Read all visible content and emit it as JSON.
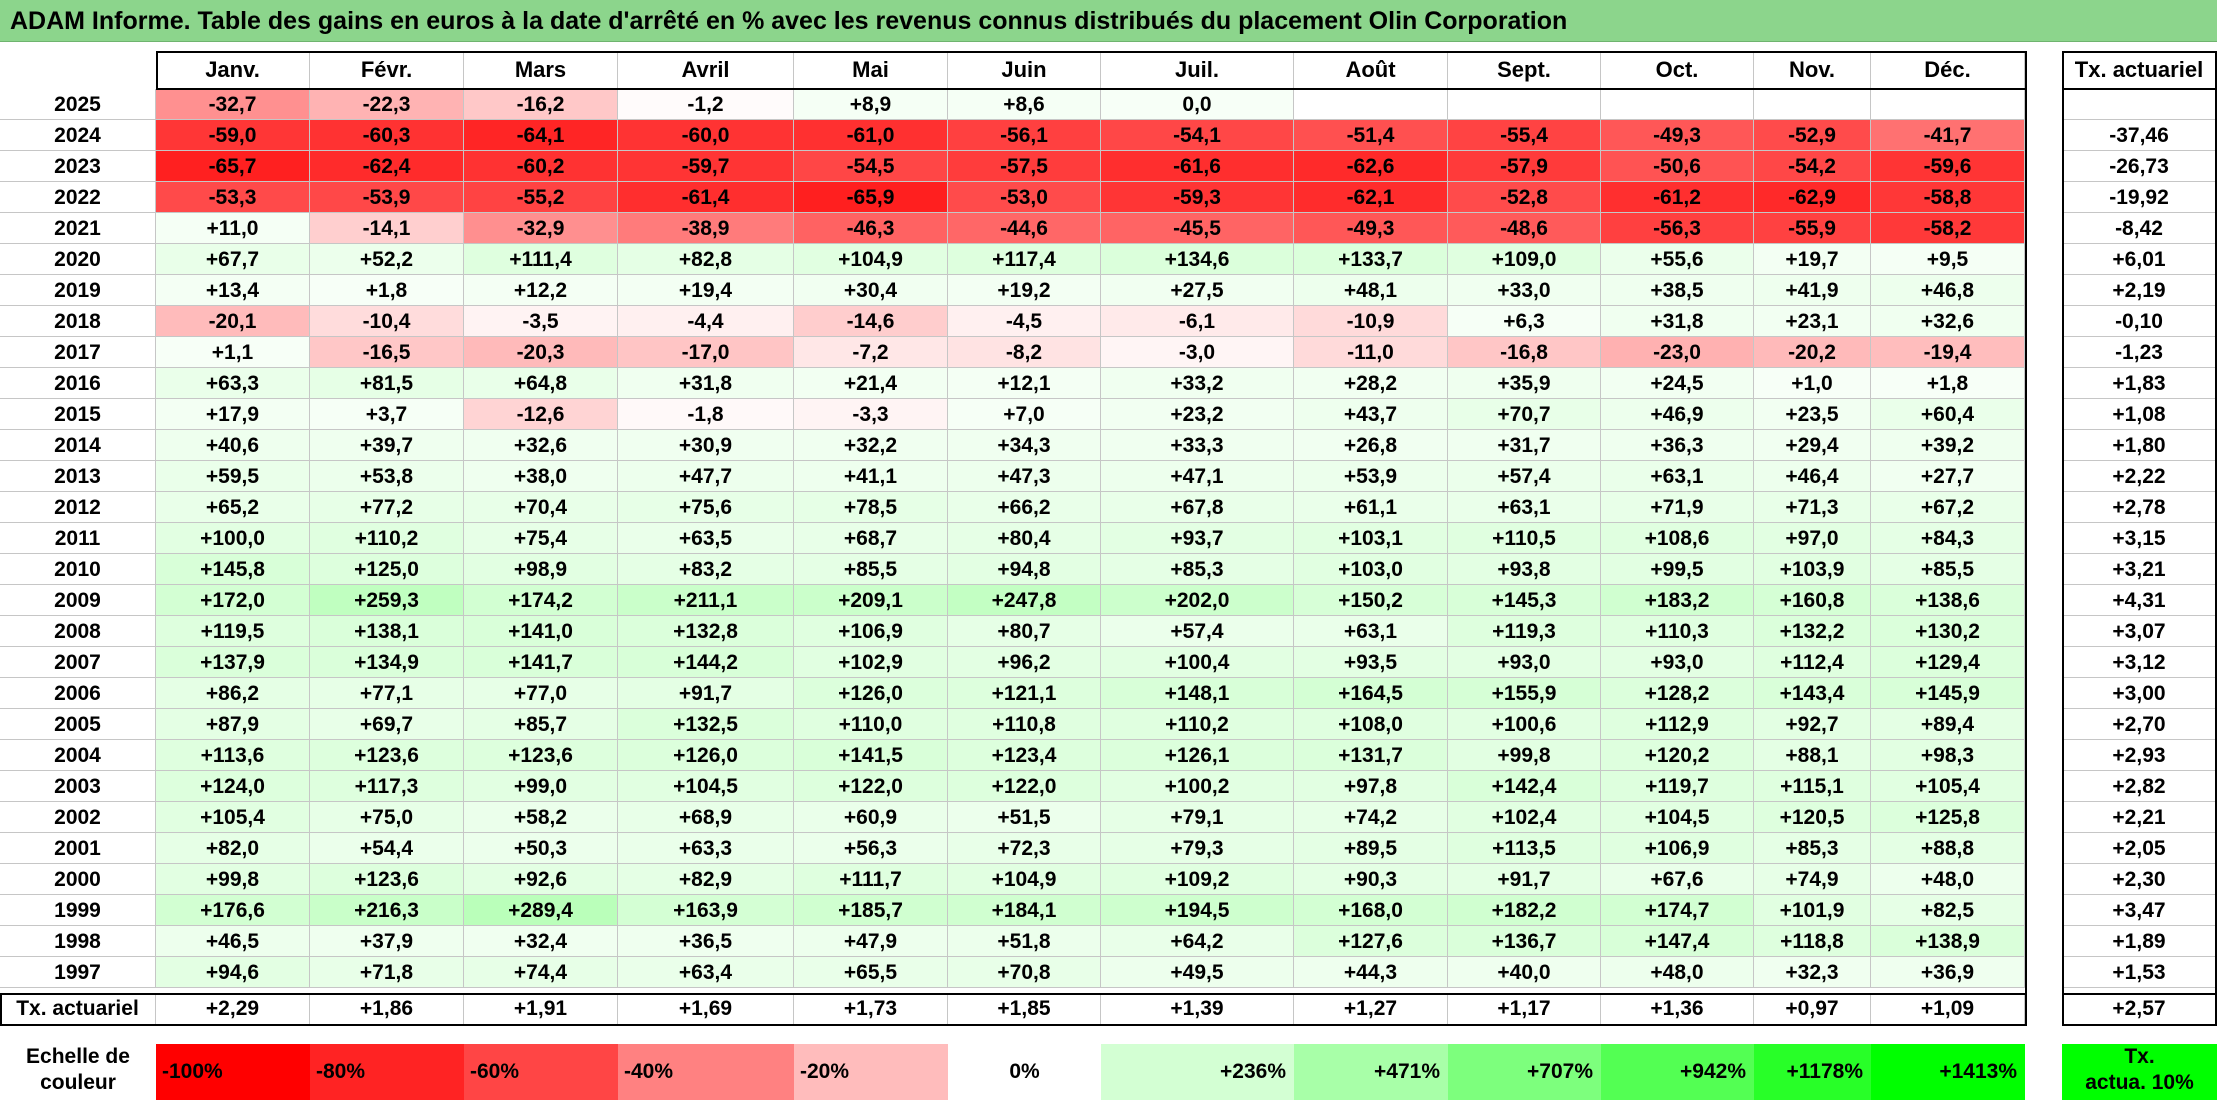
{
  "title": "ADAM Informe. Table des gains en euros à la date d'arrêté en % avec les revenus connus distribués du placement Olin Corporation",
  "months": [
    "Janv.",
    "Févr.",
    "Mars",
    "Avril",
    "Mai",
    "Juin",
    "Juil.",
    "Août",
    "Sept.",
    "Oct.",
    "Nov.",
    "Déc."
  ],
  "tx_header": "Tx. actuariel",
  "rows": [
    {
      "year": "2025",
      "cells": [
        "-32,7",
        "-22,3",
        "-16,2",
        "-1,2",
        "+8,9",
        "+8,6",
        "0,0",
        "",
        "",
        "",
        "",
        ""
      ],
      "tx": ""
    },
    {
      "year": "2024",
      "cells": [
        "-59,0",
        "-60,3",
        "-64,1",
        "-60,0",
        "-61,0",
        "-56,1",
        "-54,1",
        "-51,4",
        "-55,4",
        "-49,3",
        "-52,9",
        "-41,7"
      ],
      "tx": "-37,46"
    },
    {
      "year": "2023",
      "cells": [
        "-65,7",
        "-62,4",
        "-60,2",
        "-59,7",
        "-54,5",
        "-57,5",
        "-61,6",
        "-62,6",
        "-57,9",
        "-50,6",
        "-54,2",
        "-59,6"
      ],
      "tx": "-26,73"
    },
    {
      "year": "2022",
      "cells": [
        "-53,3",
        "-53,9",
        "-55,2",
        "-61,4",
        "-65,9",
        "-53,0",
        "-59,3",
        "-62,1",
        "-52,8",
        "-61,2",
        "-62,9",
        "-58,8"
      ],
      "tx": "-19,92"
    },
    {
      "year": "2021",
      "cells": [
        "+11,0",
        "-14,1",
        "-32,9",
        "-38,9",
        "-46,3",
        "-44,6",
        "-45,5",
        "-49,3",
        "-48,6",
        "-56,3",
        "-55,9",
        "-58,2"
      ],
      "tx": "-8,42"
    },
    {
      "year": "2020",
      "cells": [
        "+67,7",
        "+52,2",
        "+111,4",
        "+82,8",
        "+104,9",
        "+117,4",
        "+134,6",
        "+133,7",
        "+109,0",
        "+55,6",
        "+19,7",
        "+9,5"
      ],
      "tx": "+6,01"
    },
    {
      "year": "2019",
      "cells": [
        "+13,4",
        "+1,8",
        "+12,2",
        "+19,4",
        "+30,4",
        "+19,2",
        "+27,5",
        "+48,1",
        "+33,0",
        "+38,5",
        "+41,9",
        "+46,8"
      ],
      "tx": "+2,19"
    },
    {
      "year": "2018",
      "cells": [
        "-20,1",
        "-10,4",
        "-3,5",
        "-4,4",
        "-14,6",
        "-4,5",
        "-6,1",
        "-10,9",
        "+6,3",
        "+31,8",
        "+23,1",
        "+32,6"
      ],
      "tx": "-0,10"
    },
    {
      "year": "2017",
      "cells": [
        "+1,1",
        "-16,5",
        "-20,3",
        "-17,0",
        "-7,2",
        "-8,2",
        "-3,0",
        "-11,0",
        "-16,8",
        "-23,0",
        "-20,2",
        "-19,4"
      ],
      "tx": "-1,23"
    },
    {
      "year": "2016",
      "cells": [
        "+63,3",
        "+81,5",
        "+64,8",
        "+31,8",
        "+21,4",
        "+12,1",
        "+33,2",
        "+28,2",
        "+35,9",
        "+24,5",
        "+1,0",
        "+1,8"
      ],
      "tx": "+1,83"
    },
    {
      "year": "2015",
      "cells": [
        "+17,9",
        "+3,7",
        "-12,6",
        "-1,8",
        "-3,3",
        "+7,0",
        "+23,2",
        "+43,7",
        "+70,7",
        "+46,9",
        "+23,5",
        "+60,4"
      ],
      "tx": "+1,08"
    },
    {
      "year": "2014",
      "cells": [
        "+40,6",
        "+39,7",
        "+32,6",
        "+30,9",
        "+32,2",
        "+34,3",
        "+33,3",
        "+26,8",
        "+31,7",
        "+36,3",
        "+29,4",
        "+39,2"
      ],
      "tx": "+1,80"
    },
    {
      "year": "2013",
      "cells": [
        "+59,5",
        "+53,8",
        "+38,0",
        "+47,7",
        "+41,1",
        "+47,3",
        "+47,1",
        "+53,9",
        "+57,4",
        "+63,1",
        "+46,4",
        "+27,7"
      ],
      "tx": "+2,22"
    },
    {
      "year": "2012",
      "cells": [
        "+65,2",
        "+77,2",
        "+70,4",
        "+75,6",
        "+78,5",
        "+66,2",
        "+67,8",
        "+61,1",
        "+63,1",
        "+71,9",
        "+71,3",
        "+67,2"
      ],
      "tx": "+2,78"
    },
    {
      "year": "2011",
      "cells": [
        "+100,0",
        "+110,2",
        "+75,4",
        "+63,5",
        "+68,7",
        "+80,4",
        "+93,7",
        "+103,1",
        "+110,5",
        "+108,6",
        "+97,0",
        "+84,3"
      ],
      "tx": "+3,15"
    },
    {
      "year": "2010",
      "cells": [
        "+145,8",
        "+125,0",
        "+98,9",
        "+83,2",
        "+85,5",
        "+94,8",
        "+85,3",
        "+103,0",
        "+93,8",
        "+99,5",
        "+103,9",
        "+85,5"
      ],
      "tx": "+3,21"
    },
    {
      "year": "2009",
      "cells": [
        "+172,0",
        "+259,3",
        "+174,2",
        "+211,1",
        "+209,1",
        "+247,8",
        "+202,0",
        "+150,2",
        "+145,3",
        "+183,2",
        "+160,8",
        "+138,6"
      ],
      "tx": "+4,31"
    },
    {
      "year": "2008",
      "cells": [
        "+119,5",
        "+138,1",
        "+141,0",
        "+132,8",
        "+106,9",
        "+80,7",
        "+57,4",
        "+63,1",
        "+119,3",
        "+110,3",
        "+132,2",
        "+130,2"
      ],
      "tx": "+3,07"
    },
    {
      "year": "2007",
      "cells": [
        "+137,9",
        "+134,9",
        "+141,7",
        "+144,2",
        "+102,9",
        "+96,2",
        "+100,4",
        "+93,5",
        "+93,0",
        "+93,0",
        "+112,4",
        "+129,4"
      ],
      "tx": "+3,12"
    },
    {
      "year": "2006",
      "cells": [
        "+86,2",
        "+77,1",
        "+77,0",
        "+91,7",
        "+126,0",
        "+121,1",
        "+148,1",
        "+164,5",
        "+155,9",
        "+128,2",
        "+143,4",
        "+145,9"
      ],
      "tx": "+3,00"
    },
    {
      "year": "2005",
      "cells": [
        "+87,9",
        "+69,7",
        "+85,7",
        "+132,5",
        "+110,0",
        "+110,8",
        "+110,2",
        "+108,0",
        "+100,6",
        "+112,9",
        "+92,7",
        "+89,4"
      ],
      "tx": "+2,70"
    },
    {
      "year": "2004",
      "cells": [
        "+113,6",
        "+123,6",
        "+123,6",
        "+126,0",
        "+141,5",
        "+123,4",
        "+126,1",
        "+131,7",
        "+99,8",
        "+120,2",
        "+88,1",
        "+98,3"
      ],
      "tx": "+2,93"
    },
    {
      "year": "2003",
      "cells": [
        "+124,0",
        "+117,3",
        "+99,0",
        "+104,5",
        "+122,0",
        "+122,0",
        "+100,2",
        "+97,8",
        "+142,4",
        "+119,7",
        "+115,1",
        "+105,4"
      ],
      "tx": "+2,82"
    },
    {
      "year": "2002",
      "cells": [
        "+105,4",
        "+75,0",
        "+58,2",
        "+68,9",
        "+60,9",
        "+51,5",
        "+79,1",
        "+74,2",
        "+102,4",
        "+104,5",
        "+120,5",
        "+125,8"
      ],
      "tx": "+2,21"
    },
    {
      "year": "2001",
      "cells": [
        "+82,0",
        "+54,4",
        "+50,3",
        "+63,3",
        "+56,3",
        "+72,3",
        "+79,3",
        "+89,5",
        "+113,5",
        "+106,9",
        "+85,3",
        "+88,8"
      ],
      "tx": "+2,05"
    },
    {
      "year": "2000",
      "cells": [
        "+99,8",
        "+123,6",
        "+92,6",
        "+82,9",
        "+111,7",
        "+104,9",
        "+109,2",
        "+90,3",
        "+91,7",
        "+67,6",
        "+74,9",
        "+48,0"
      ],
      "tx": "+2,30"
    },
    {
      "year": "1999",
      "cells": [
        "+176,6",
        "+216,3",
        "+289,4",
        "+163,9",
        "+185,7",
        "+184,1",
        "+194,5",
        "+168,0",
        "+182,2",
        "+174,7",
        "+101,9",
        "+82,5"
      ],
      "tx": "+3,47"
    },
    {
      "year": "1998",
      "cells": [
        "+46,5",
        "+37,9",
        "+32,4",
        "+36,5",
        "+47,9",
        "+51,8",
        "+64,2",
        "+127,6",
        "+136,7",
        "+147,4",
        "+118,8",
        "+138,9"
      ],
      "tx": "+1,89"
    },
    {
      "year": "1997",
      "cells": [
        "+94,6",
        "+71,8",
        "+74,4",
        "+63,4",
        "+65,5",
        "+70,8",
        "+49,5",
        "+44,3",
        "+40,0",
        "+48,0",
        "+32,3",
        "+36,9"
      ],
      "tx": "+1,53"
    }
  ],
  "footer": {
    "label": "Tx. actuariel",
    "cells": [
      "+2,29",
      "+1,86",
      "+1,91",
      "+1,69",
      "+1,73",
      "+1,85",
      "+1,39",
      "+1,27",
      "+1,17",
      "+1,36",
      "+0,97",
      "+1,09"
    ],
    "tx": "+2,57"
  },
  "scale": {
    "label_line1": "Echelle de",
    "label_line2": "couleur",
    "items": [
      {
        "text": "-100%",
        "color": "#ff0000"
      },
      {
        "text": "-80%",
        "color": "#ff2323"
      },
      {
        "text": "-60%",
        "color": "#ff4545"
      },
      {
        "text": "-40%",
        "color": "#ff8181"
      },
      {
        "text": "-20%",
        "color": "#ffbcbc"
      },
      {
        "text": "0%",
        "color": "#ffffff"
      },
      {
        "text": "+236%",
        "color": "#d3ffd3"
      },
      {
        "text": "+471%",
        "color": "#a8ffa8"
      },
      {
        "text": "+707%",
        "color": "#7dff7d"
      },
      {
        "text": "+942%",
        "color": "#53ff53"
      },
      {
        "text": "+1178%",
        "color": "#28ff28"
      },
      {
        "text": "+1413%",
        "color": "#00ff00"
      }
    ],
    "tx_line1": "Tx.",
    "tx_line2": "actua. 10%",
    "tx_color": "#00ff00"
  },
  "colors": {
    "title_bg": "#8cd58c",
    "negative": "#ff0000",
    "positive": "#00ff00",
    "neutral": "#ffffff"
  }
}
